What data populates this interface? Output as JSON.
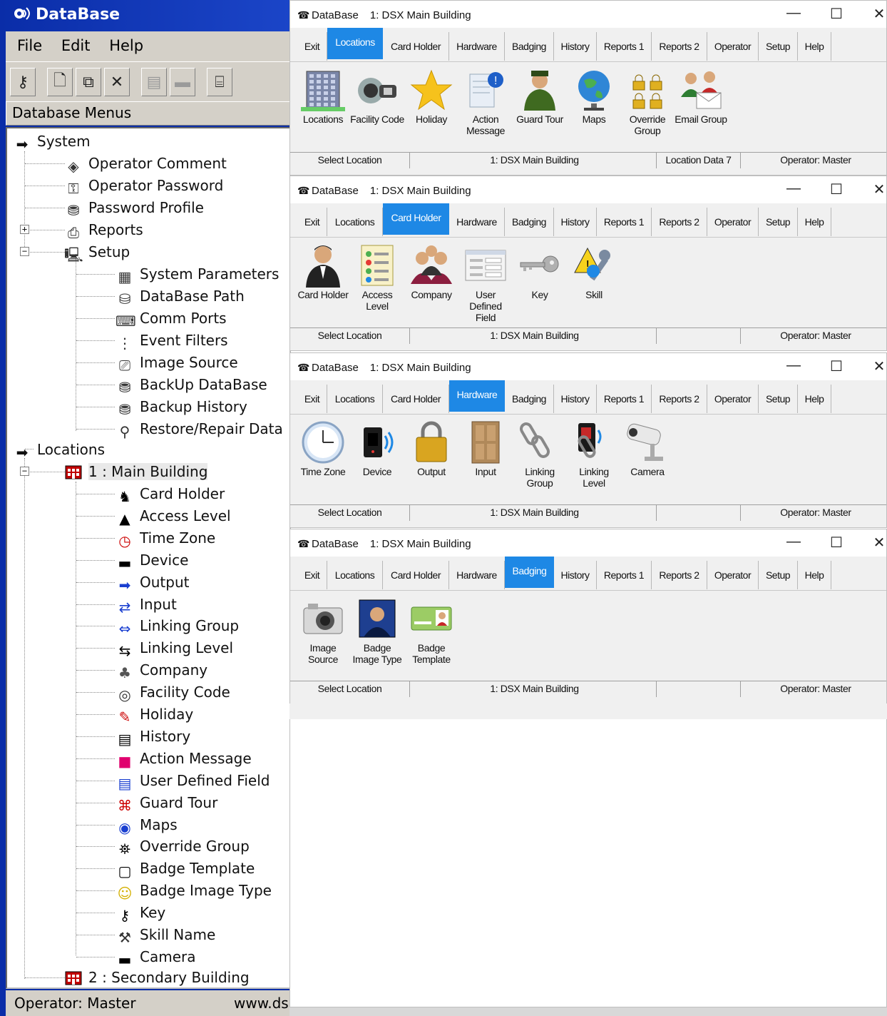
{
  "legacy": {
    "title": "DataBase",
    "menu": [
      "File",
      "Edit",
      "Help"
    ],
    "header": "Database Menus",
    "tree": {
      "system": "System",
      "system_items": [
        "Operator Comment",
        "Operator Password",
        "Password Profile",
        "Reports",
        "Setup"
      ],
      "setup_items": [
        "System Parameters",
        "DataBase Path",
        "Comm Ports",
        "Event Filters",
        "Image Source",
        "BackUp DataBase",
        "Backup History",
        "Restore/Repair Data"
      ],
      "locations": "Locations",
      "main_building": "1 : Main Building",
      "main_items": [
        "Card Holder",
        "Access Level",
        "Time Zone",
        "Device",
        "Output",
        "Input",
        "Linking Group",
        "Linking Level",
        "Company",
        "Facility Code",
        "Holiday",
        "History",
        "Action Message",
        "User Defined Field",
        "Guard Tour",
        "Maps",
        "Override Group",
        "Badge Template",
        "Badge Image Type",
        "Key",
        "Skill Name",
        "Camera"
      ],
      "secondary_building": "2 : Secondary Building"
    },
    "status": {
      "operator": "Operator:  Master",
      "url": "www.ds"
    }
  },
  "windows": [
    {
      "app": "DataBase",
      "location": "1: DSX Main Building",
      "active_tab": "Locations",
      "icons": [
        {
          "label": "Locations",
          "icon": "building-icon"
        },
        {
          "label": "Facility Code",
          "icon": "key-lock-icon"
        },
        {
          "label": "Holiday",
          "icon": "star-icon"
        },
        {
          "label": "Action Message",
          "icon": "message-icon"
        },
        {
          "label": "Guard Tour",
          "icon": "guard-icon"
        },
        {
          "label": "Maps",
          "icon": "globe-icon"
        },
        {
          "label": "Override Group",
          "icon": "padlocks-icon"
        },
        {
          "label": "Email Group",
          "icon": "people-email-icon"
        }
      ],
      "status": [
        "Select Location",
        "1: DSX Main Building",
        "Location Data   7",
        "Operator:  Master"
      ]
    },
    {
      "app": "DataBase",
      "location": "1: DSX Main Building",
      "active_tab": "Card Holder",
      "icons": [
        {
          "label": "Card Holder",
          "icon": "person-icon"
        },
        {
          "label": "Access Level",
          "icon": "checklist-icon"
        },
        {
          "label": "Company",
          "icon": "group-icon"
        },
        {
          "label": "User Defined Field",
          "icon": "form-icon"
        },
        {
          "label": "Key",
          "icon": "key-icon"
        },
        {
          "label": "Skill",
          "icon": "skill-tools-icon"
        }
      ],
      "status": [
        "Select Location",
        "1: DSX Main Building",
        "",
        "Operator:  Master"
      ]
    },
    {
      "app": "DataBase",
      "location": "1: DSX Main Building",
      "active_tab": "Hardware",
      "icons": [
        {
          "label": "Time Zone",
          "icon": "clock-icon"
        },
        {
          "label": "Device",
          "icon": "reader-icon"
        },
        {
          "label": "Output",
          "icon": "padlock-icon"
        },
        {
          "label": "Input",
          "icon": "door-icon"
        },
        {
          "label": "Linking Group",
          "icon": "chain-icon"
        },
        {
          "label": "Linking Level",
          "icon": "chain-reader-icon"
        },
        {
          "label": "Camera",
          "icon": "camera-icon"
        }
      ],
      "status": [
        "Select Location",
        "1: DSX Main Building",
        "",
        "Operator:  Master"
      ]
    },
    {
      "app": "DataBase",
      "location": "1: DSX Main Building",
      "active_tab": "Badging",
      "icons": [
        {
          "label": "Image Source",
          "icon": "photo-camera-icon"
        },
        {
          "label": "Badge Image Type",
          "icon": "portrait-icon"
        },
        {
          "label": "Badge Template",
          "icon": "badge-card-icon"
        }
      ],
      "status": [
        "Select Location",
        "1: DSX Main Building",
        "",
        "Operator:  Master"
      ]
    }
  ],
  "tabs": [
    "Exit",
    "Locations",
    "Card Holder",
    "Hardware",
    "Badging",
    "History",
    "Reports 1",
    "Reports 2",
    "Operator",
    "Setup",
    "Help"
  ],
  "colors": {
    "legacy_title": "#0a2da8",
    "active_tab": "#1e88e5",
    "window_bg": "#f0f0f0",
    "tree_bg": "#ffffff"
  }
}
